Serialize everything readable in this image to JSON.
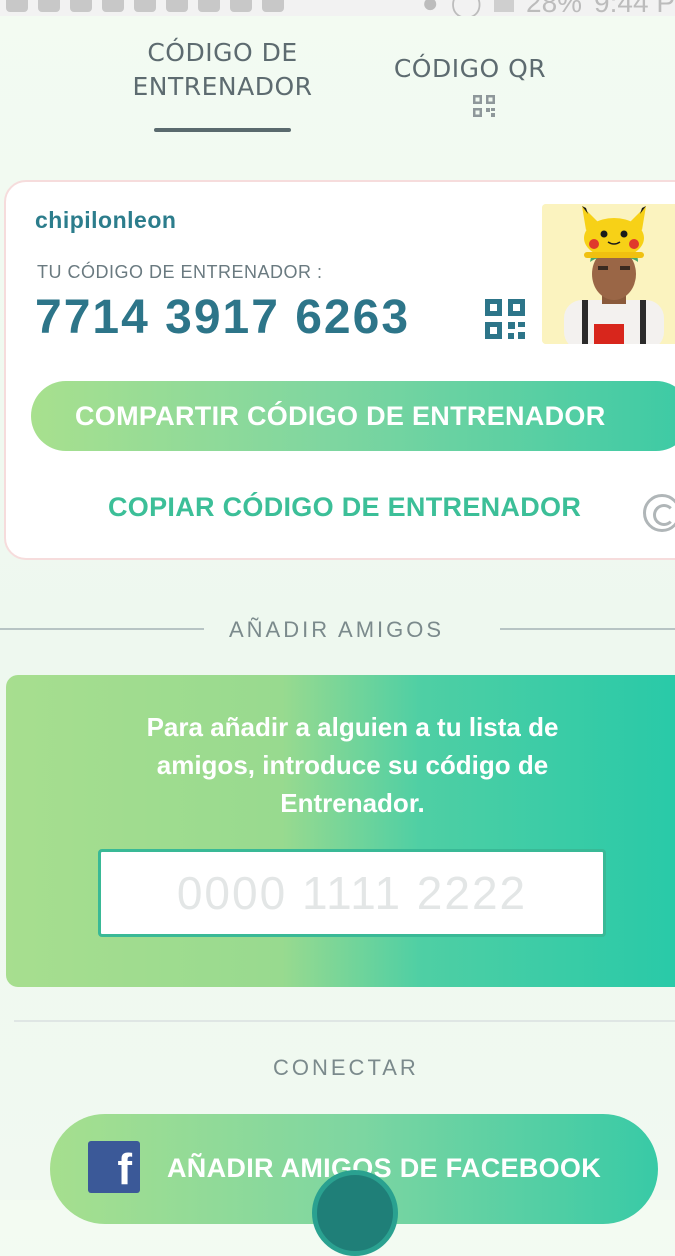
{
  "status_bar": {
    "battery": "28%",
    "time": "9:44 P"
  },
  "tabs": {
    "trainer_code_line1": "CÓDIGO DE",
    "trainer_code_line2": "ENTRENADOR",
    "qr_code": "CÓDIGO QR"
  },
  "trainer_card": {
    "username": "chipilonleon",
    "code_label": "TU CÓDIGO DE ENTRENADOR :",
    "code_value": "7714 3917 6263",
    "share_button": "COMPARTIR CÓDIGO DE ENTRENADOR",
    "copy_button": "COPIAR CÓDIGO DE ENTRENADOR"
  },
  "add_friends": {
    "section_title": "AÑADIR AMIGOS",
    "instruction": "Para añadir a alguien a tu lista de amigos, introduce su código de Entrenador.",
    "input_placeholder": "0000 1111 2222"
  },
  "connect": {
    "section_title": "CONECTAR",
    "facebook_button": "AÑADIR AMIGOS DE FACEBOOK",
    "facebook_icon_glyph": "f"
  },
  "colors": {
    "accent_teal": "#2d7589",
    "accent_green": "#3cbf98",
    "facebook_blue": "#3b5998"
  }
}
